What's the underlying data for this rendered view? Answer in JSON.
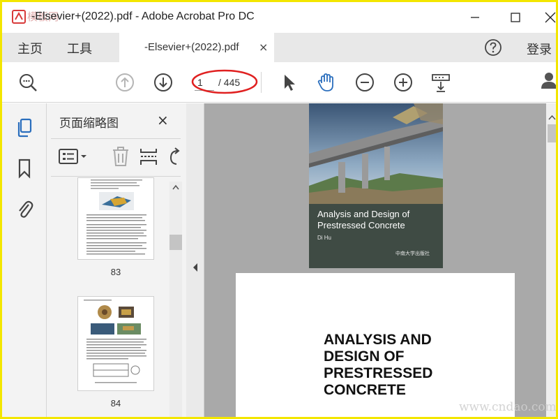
{
  "window": {
    "title": "-Elsevier+(2022).pdf - Adobe Acrobat Pro DC",
    "watermark_logo": "模板网"
  },
  "nav": {
    "home": "主页",
    "tools": "工具",
    "login": "登录"
  },
  "tab": {
    "label": "-Elsevier+(2022).pdf",
    "close": "×"
  },
  "toolbar": {
    "current_page": "1",
    "total_pages": "/ 445"
  },
  "thumbnails": {
    "title": "页面缩略图",
    "close": "×",
    "pages": [
      {
        "label": "83"
      },
      {
        "label": "84"
      }
    ]
  },
  "document": {
    "cover_title": "Analysis and Design of Prestressed Concrete",
    "cover_author": "Di Hu",
    "cover_publisher": "中南大学出版社",
    "page_title": "ANALYSIS AND DESIGN OF PRESTRESSED CONCRETE"
  },
  "watermark": "www.cndao.com",
  "colors": {
    "frame": "#f3e600",
    "annotation_oval": "#e02020",
    "cover_band": "#3f4b44",
    "doc_background": "#a9a9a9"
  },
  "icons": {
    "search": "magnifier-icon",
    "prev": "arrow-up-circle-icon",
    "next": "arrow-down-circle-icon",
    "select": "cursor-arrow-icon",
    "hand": "hand-icon",
    "zoom_out": "zoom-out-icon",
    "zoom_in": "zoom-in-icon",
    "scroll_mode": "scroll-mode-icon",
    "help": "help-icon",
    "share": "add-user-icon"
  }
}
